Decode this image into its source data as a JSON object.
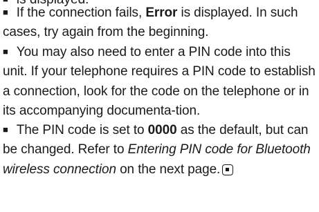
{
  "cut_line": {
    "text": "is displayed."
  },
  "paragraphs": [
    {
      "before": "If the connection fails, ",
      "bold": "Error",
      "after": " is displayed. In such cases, try again from the beginning."
    },
    {
      "text": "You may also need to enter a PIN code into this unit. If your telephone requires a PIN code to establish a connection, look for the code on the telephone or in its accompanying documenta-tion."
    },
    {
      "before": "The PIN code is set to ",
      "bold": "0000",
      "middle": " as the default, but can be changed. Refer to ",
      "italic": "Entering PIN code for Bluetooth wireless connection",
      "after": " on the next page."
    }
  ],
  "icons": {
    "bullet": "square-bullet-icon",
    "end_mark": "end-of-section-icon"
  }
}
